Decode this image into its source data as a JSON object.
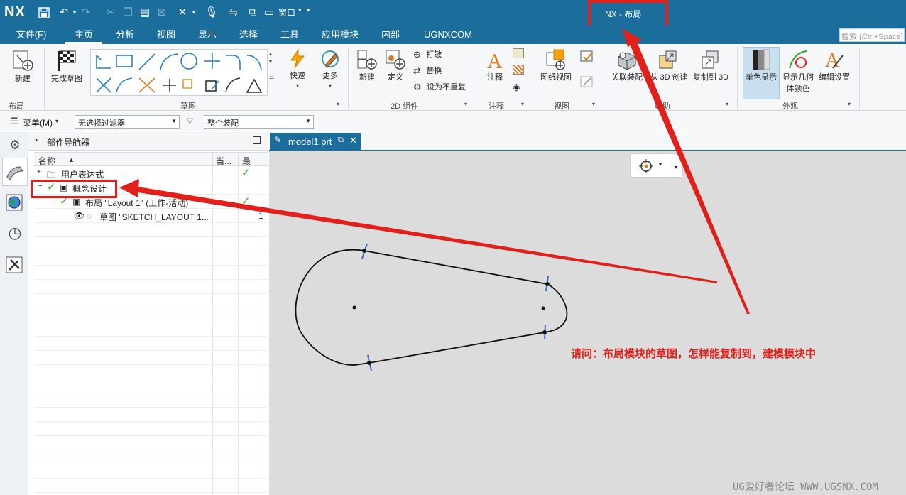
{
  "app": {
    "logo": "NX",
    "title": "NX - 布局",
    "window_menu": "窗口"
  },
  "quick_access": {
    "icons": [
      "save-icon",
      "undo-icon",
      "redo-icon",
      "cut-icon",
      "copy-icon",
      "paste-icon",
      "delete-icon",
      "command-finder-icon",
      "voice-icon",
      "view-icon",
      "window-icon"
    ]
  },
  "menu": {
    "file": "文件(F)",
    "tabs": [
      "主页",
      "分析",
      "视图",
      "显示",
      "选择",
      "工具",
      "应用模块",
      "内部",
      "UGNXCOM"
    ],
    "active_tab": "主页",
    "search_placeholder": "搜索 (Ctrl+Space)"
  },
  "ribbon": {
    "layout_new": "新建",
    "finish_sketch": "完成草图",
    "quick": "快速",
    "more": "更多",
    "comp_new": "新建",
    "define": "定义",
    "explode": "打散",
    "replace": "替换",
    "set_nonrepeat": "设为不重复",
    "annotate": "注释",
    "drawing_view": "图纸视图",
    "assoc_assembly": "关联装配",
    "from_3d": "从 3D 创建",
    "copy_to_3d": "复制到 3D",
    "mono_display": "单色显示",
    "show_geom_color_1": "显示几何",
    "show_geom_color_2": "体颜色",
    "edit_settings": "编辑设置",
    "groups": {
      "layout": "布局",
      "sketch": "草图",
      "comp2d": "2D 组件",
      "annotation": "注释",
      "view": "视图",
      "assist": "辅助",
      "appearance": "外观"
    }
  },
  "filterbar": {
    "menu": "菜单(M)",
    "filter": "无选择过滤器",
    "assembly": "整个装配"
  },
  "navigator": {
    "title": "部件导航器",
    "columns": {
      "name": "名称",
      "current": "当...",
      "latest": "最"
    },
    "rows": [
      {
        "label": "用户表达式"
      },
      {
        "label": "概念设计"
      },
      {
        "label": "布局 \"Layout 1\" (工作-活动)"
      },
      {
        "label": "草图 \"SKETCH_LAYOUT 1...",
        "extra": "1"
      }
    ]
  },
  "graphics": {
    "tab_label": "model1.prt",
    "note": "请问：布局模块的草图，怎样能复制到，建模模块中",
    "watermark": "UG爱好者论坛 WWW.UGSNX.COM"
  },
  "colors": {
    "titlebar": "#1b6e9b",
    "annotation_red": "#e0211b",
    "check_green": "#2aa52a"
  }
}
